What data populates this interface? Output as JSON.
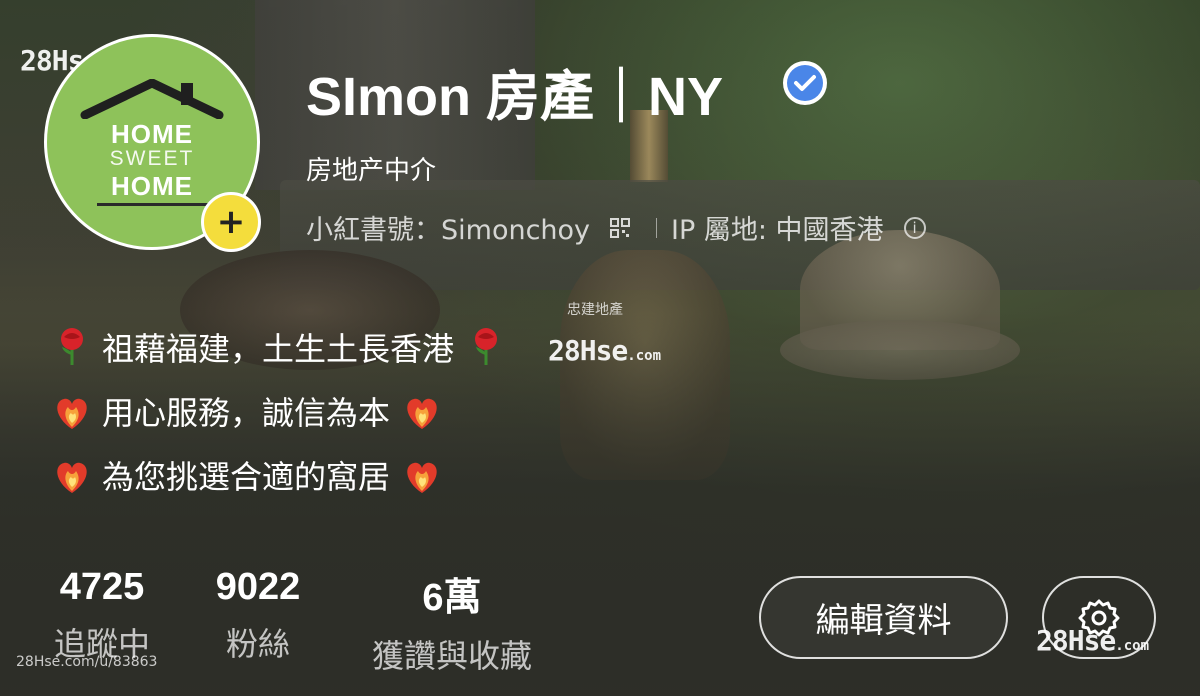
{
  "profile": {
    "name": "SImon 房產｜NY",
    "subtitle": "房地产中介",
    "id_label": "小紅書號：Simonchoy",
    "ip_label": "IP 屬地: 中國香港",
    "avatar": {
      "line1": "HOME",
      "line2": "SWEET",
      "line3": "HOME"
    }
  },
  "bio": [
    "祖藉福建，土生土長香港",
    "用心服務，誠信為本",
    "為您挑選合適的窩居"
  ],
  "stats": [
    {
      "value": "4725",
      "label": "追蹤中"
    },
    {
      "value": "9022",
      "label": "粉絲"
    },
    {
      "value": "6萬",
      "label": "獲讚與收藏"
    }
  ],
  "actions": {
    "edit_label": "編輯資料"
  },
  "watermarks": {
    "brand": "28Hse",
    "domain": ".com",
    "agency": "忠建地產",
    "listing_ref": "28Hse.com/u/83863"
  },
  "icons": {
    "verified": "verified-badge-icon",
    "qr": "qr-code-icon",
    "info": "info-icon",
    "gear": "gear-icon",
    "plus": "plus-icon",
    "rose": "rose-emoji",
    "heart": "heart-on-fire-emoji"
  },
  "colors": {
    "verified_blue": "#4a86e8",
    "avatar_green": "#8ec25a",
    "plus_yellow": "#f4dd3c"
  }
}
